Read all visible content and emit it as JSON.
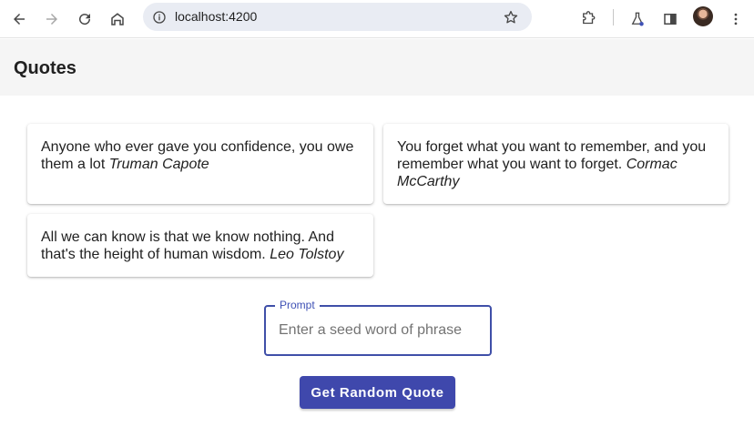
{
  "browser": {
    "url": "localhost:4200",
    "icons": [
      "back-icon",
      "forward-icon",
      "reload-icon",
      "home-icon",
      "site-info-icon",
      "bookmark-star-icon",
      "extensions-icon",
      "labs-icon",
      "side-panel-icon",
      "profile-avatar",
      "more-menu-icon"
    ]
  },
  "app": {
    "title": "Quotes"
  },
  "quotes": [
    {
      "text": "Anyone who ever gave you confidence, you owe them a lot",
      "author": "Truman Capote"
    },
    {
      "text": "You forget what you want to remember, and you remember what you want to forget.",
      "author": "Cormac McCarthy"
    },
    {
      "text": "All we can know is that we know nothing. And that's the height of human wisdom.",
      "author": "Leo Tolstoy"
    }
  ],
  "prompt": {
    "label": "Prompt",
    "placeholder": "Enter a seed word of phrase",
    "value": ""
  },
  "action": {
    "button_label": "Get Random Quote"
  },
  "colors": {
    "accent": "#3f48ac",
    "toolbar_bg": "#f5f5f5",
    "omnibox_bg": "#e9ecf3"
  }
}
